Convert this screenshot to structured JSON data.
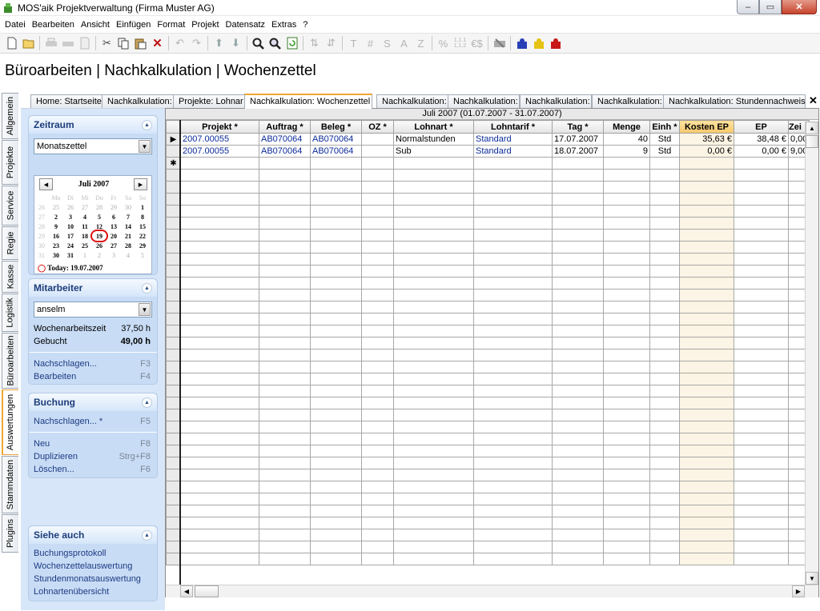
{
  "window": {
    "title": "MOS'aik Projektverwaltung (Firma Muster AG)",
    "minimize": "–",
    "maximize": "▭",
    "close": "✕"
  },
  "menu": [
    "Datei",
    "Bearbeiten",
    "Ansicht",
    "Einfügen",
    "Format",
    "Projekt",
    "Datensatz",
    "Extras",
    "?"
  ],
  "toolbar_text": {
    "T": "T",
    "hash": "#",
    "S": "S",
    "A": "A",
    "Z": "Z",
    "percent": "%",
    "num": "1,1.1\n1,1.2",
    "euro": "€$"
  },
  "heading": "Büroarbeiten | Nachkalkulation | Wochenzettel",
  "vertical_tabs": [
    "Allgemein",
    "Projekte",
    "Service",
    "Regie",
    "Kasse",
    "Logistik",
    "Büroarbeiten",
    "Auswertungen",
    "Stammdaten",
    "Plugins"
  ],
  "active_vertical_tab": "Auswertungen",
  "top_tabs": [
    "Home: Startseite",
    "Nachkalkulation:",
    "Projekte: Lohnar",
    "Nachkalkulation: Wochenzettel",
    "Nachkalkulation:",
    "Nachkalkulation:",
    "Nachkalkulation:",
    "Nachkalkulation:",
    "Nachkalkulation: Stundennachweis"
  ],
  "close_tab": "✕",
  "zeitraum": {
    "title": "Zeitraum",
    "select_value": "Monatszettel",
    "calendar": {
      "month": "Juli 2007",
      "prev": "◀",
      "next": "▶",
      "weekdays": [
        "Mo",
        "Di",
        "Mi",
        "Do",
        "Fr",
        "Sa",
        "So"
      ],
      "weeks": [
        [
          "26",
          "25",
          "26",
          "27",
          "28",
          "29",
          "30",
          "1"
        ],
        [
          "27",
          "2",
          "3",
          "4",
          "5",
          "6",
          "7",
          "8"
        ],
        [
          "28",
          "9",
          "10",
          "11",
          "12",
          "13",
          "14",
          "15"
        ],
        [
          "29",
          "16",
          "17",
          "18",
          "19",
          "20",
          "21",
          "22"
        ],
        [
          "30",
          "23",
          "24",
          "25",
          "26",
          "27",
          "28",
          "29"
        ],
        [
          "31",
          "30",
          "31",
          "1",
          "2",
          "3",
          "4",
          "5"
        ]
      ],
      "today_label": "Today: 19.07.2007"
    }
  },
  "mitarbeiter": {
    "title": "Mitarbeiter",
    "select_value": "anselm",
    "wochenarbeitszeit_label": "Wochenarbeitszeit",
    "wochenarbeitszeit_value": "37,50 h",
    "gebucht_label": "Gebucht",
    "gebucht_value": "49,00 h",
    "nachschlagen": "Nachschlagen...",
    "nachschlagen_key": "F3",
    "bearbeiten": "Bearbeiten",
    "bearbeiten_key": "F4"
  },
  "buchung": {
    "title": "Buchung",
    "nachschlagen": "Nachschlagen... *",
    "nachschlagen_key": "F5",
    "neu": "Neu",
    "neu_key": "F8",
    "duplizieren": "Duplizieren",
    "duplizieren_key": "Strg+F8",
    "loeschen": "Löschen...",
    "loeschen_key": "F6"
  },
  "siehe_auch": {
    "title": "Siehe auch",
    "links": [
      "Buchungsprotokoll",
      "Wochenzettelauswertung",
      "Stundenmonatsauswertung",
      "Lohnartenübersicht"
    ]
  },
  "grid": {
    "period": "Juli 2007 (01.07.2007 - 31.07.2007)",
    "columns": [
      "Projekt *",
      "Auftrag *",
      "Beleg *",
      "OZ *",
      "Lohnart *",
      "Lohntarif *",
      "Tag *",
      "Menge",
      "Einh *",
      "Kosten EP",
      "EP",
      "Zei"
    ],
    "rows": [
      [
        "2007.00055",
        "AB070064",
        "AB070064",
        "",
        "Normalstunden",
        "Standard",
        "17.07.2007",
        "40",
        "Std",
        "35,63 €",
        "38,48 €",
        "0,00"
      ],
      [
        "2007.00055",
        "AB070064",
        "AB070064",
        "",
        "Sub",
        "Standard",
        "18.07.2007",
        "9",
        "Std",
        "0,00 €",
        "0,00 €",
        "9,00"
      ]
    ],
    "current_row_marker": "▶",
    "new_row_marker": "✱"
  }
}
